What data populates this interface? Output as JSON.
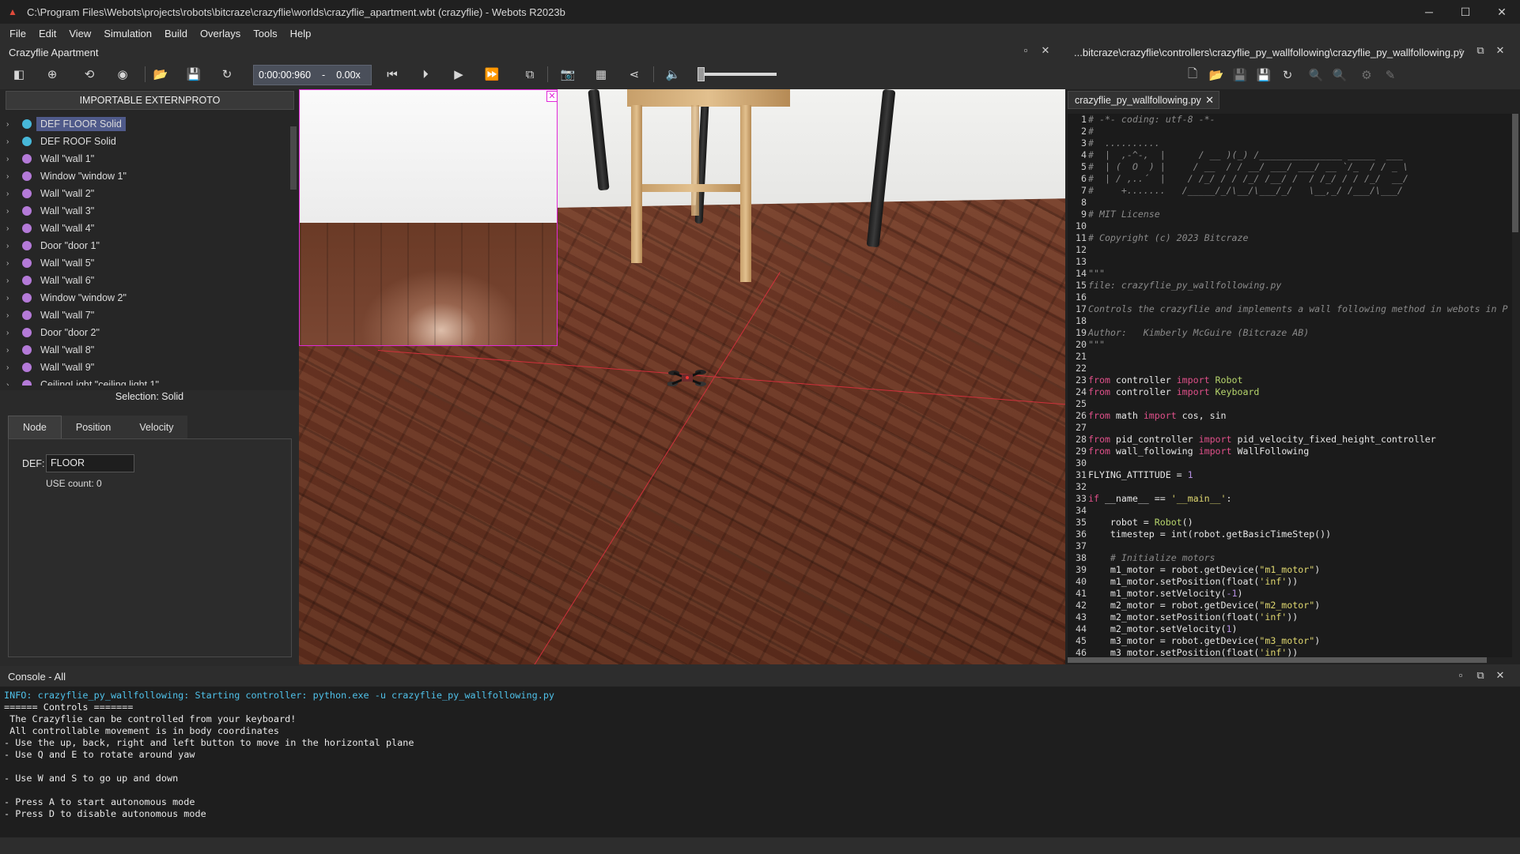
{
  "window": {
    "title": "C:\\Program Files\\Webots\\projects\\robots\\bitcraze\\crazyflie\\worlds\\crazyflie_apartment.wbt (crazyflie) - Webots R2023b"
  },
  "menu": [
    "File",
    "Edit",
    "View",
    "Simulation",
    "Build",
    "Overlays",
    "Tools",
    "Help"
  ],
  "world_panel": {
    "title": "Crazyflie Apartment",
    "time": "0:00:00:960",
    "speed": "0.00x"
  },
  "scene_tree": {
    "externproto_button": "IMPORTABLE EXTERNPROTO",
    "items": [
      {
        "label": "DEF FLOOR Solid",
        "color": "#47b8d9",
        "selected": true
      },
      {
        "label": "DEF ROOF Solid",
        "color": "#47b8d9"
      },
      {
        "label": "Wall \"wall 1\"",
        "color": "#b47ad8"
      },
      {
        "label": "Window \"window 1\"",
        "color": "#b47ad8"
      },
      {
        "label": "Wall \"wall 2\"",
        "color": "#b47ad8"
      },
      {
        "label": "Wall \"wall 3\"",
        "color": "#b47ad8"
      },
      {
        "label": "Wall \"wall 4\"",
        "color": "#b47ad8"
      },
      {
        "label": "Door \"door 1\"",
        "color": "#b47ad8"
      },
      {
        "label": "Wall \"wall 5\"",
        "color": "#b47ad8"
      },
      {
        "label": "Wall \"wall 6\"",
        "color": "#b47ad8"
      },
      {
        "label": "Window \"window 2\"",
        "color": "#b47ad8"
      },
      {
        "label": "Wall \"wall 7\"",
        "color": "#b47ad8"
      },
      {
        "label": "Door \"door 2\"",
        "color": "#b47ad8"
      },
      {
        "label": "Wall \"wall 8\"",
        "color": "#b47ad8"
      },
      {
        "label": "Wall \"wall 9\"",
        "color": "#b47ad8"
      },
      {
        "label": "CeilingLight \"ceiling light 1\"",
        "color": "#b47ad8"
      }
    ]
  },
  "selection": {
    "title": "Selection: Solid",
    "tabs": [
      "Node",
      "Position",
      "Velocity"
    ],
    "def_label": "DEF:",
    "def_value": "FLOOR",
    "use_count": "USE count: 0"
  },
  "editor": {
    "path": "...bitcraze\\crazyflie\\controllers\\crazyflie_py_wallfollowing\\crazyflie_py_wallfollowing.py",
    "tab": "crazyflie_py_wallfollowing.py"
  },
  "code_lines": [
    [
      [
        "cmt",
        "# -*- coding: utf-8 -*-"
      ]
    ],
    [
      [
        "cmt",
        "#"
      ]
    ],
    [
      [
        "cmt",
        "#  .........."
      ]
    ],
    [
      [
        "cmt",
        "#  |  ,-^-,  |      / __ )(_) /_______________ _____  ___"
      ]
    ],
    [
      [
        "cmt",
        "#  | (  O  ) |     / __  / / __/ ___/ ___/ __ `/_  / / _ \\"
      ]
    ],
    [
      [
        "cmt",
        "#  | / ,..´  |    / /_/ / / /_/ /__/ /  / /_/ / / /_/  __/"
      ]
    ],
    [
      [
        "cmt",
        "#     +.......   /_____/_/\\__/\\___/_/   \\__,_/ /___/\\___/"
      ]
    ],
    [
      [
        "ct",
        ""
      ]
    ],
    [
      [
        "cmt",
        "# MIT License"
      ]
    ],
    [
      [
        "ct",
        ""
      ]
    ],
    [
      [
        "cmt",
        "# Copyright (c) 2023 Bitcraze"
      ]
    ],
    [
      [
        "ct",
        ""
      ]
    ],
    [
      [
        "ct",
        ""
      ]
    ],
    [
      [
        "cmt",
        "\"\"\""
      ]
    ],
    [
      [
        "cmt",
        "file: crazyflie_py_wallfollowing.py"
      ]
    ],
    [
      [
        "ct",
        ""
      ]
    ],
    [
      [
        "cmt",
        "Controls the crazyflie and implements a wall following method in webots in P"
      ]
    ],
    [
      [
        "ct",
        ""
      ]
    ],
    [
      [
        "cmt",
        "Author:   Kimberly McGuire (Bitcraze AB)"
      ]
    ],
    [
      [
        "cmt",
        "\"\"\""
      ]
    ],
    [
      [
        "ct",
        ""
      ]
    ],
    [
      [
        "ct",
        ""
      ]
    ],
    [
      [
        "kw",
        "from"
      ],
      [
        "ct",
        " controller "
      ],
      [
        "kw",
        "import"
      ],
      [
        "cls",
        " Robot"
      ]
    ],
    [
      [
        "kw",
        "from"
      ],
      [
        "ct",
        " controller "
      ],
      [
        "kw",
        "import"
      ],
      [
        "cls",
        " Keyboard"
      ]
    ],
    [
      [
        "ct",
        ""
      ]
    ],
    [
      [
        "kw",
        "from"
      ],
      [
        "ct",
        " math "
      ],
      [
        "kw",
        "import"
      ],
      [
        "ct",
        " cos, sin"
      ]
    ],
    [
      [
        "ct",
        ""
      ]
    ],
    [
      [
        "kw",
        "from"
      ],
      [
        "ct",
        " pid_controller "
      ],
      [
        "kw",
        "import"
      ],
      [
        "ct",
        " pid_velocity_fixed_height_controller"
      ]
    ],
    [
      [
        "kw",
        "from"
      ],
      [
        "ct",
        " wall_following "
      ],
      [
        "kw",
        "import"
      ],
      [
        "ct",
        " WallFollowing"
      ]
    ],
    [
      [
        "ct",
        ""
      ]
    ],
    [
      [
        "ct",
        "FLYING_ATTITUDE = "
      ],
      [
        "num",
        "1"
      ]
    ],
    [
      [
        "ct",
        ""
      ]
    ],
    [
      [
        "kw",
        "if"
      ],
      [
        "ct",
        " __name__ == "
      ],
      [
        "str",
        "'__main__'"
      ],
      [
        "ct",
        ":"
      ]
    ],
    [
      [
        "ct",
        ""
      ]
    ],
    [
      [
        "ct",
        "    robot = "
      ],
      [
        "cls",
        "Robot"
      ],
      [
        "ct",
        "()"
      ]
    ],
    [
      [
        "ct",
        "    timestep = int(robot.getBasicTimeStep())"
      ]
    ],
    [
      [
        "ct",
        ""
      ]
    ],
    [
      [
        "cmt",
        "    # Initialize motors"
      ]
    ],
    [
      [
        "ct",
        "    m1_motor = robot.getDevice("
      ],
      [
        "str",
        "\"m1_motor\""
      ],
      [
        "ct",
        ")"
      ]
    ],
    [
      [
        "ct",
        "    m1_motor.setPosition(float("
      ],
      [
        "str",
        "'inf'"
      ],
      [
        "ct",
        "))"
      ]
    ],
    [
      [
        "ct",
        "    m1_motor.setVelocity("
      ],
      [
        "num",
        "-1"
      ],
      [
        "ct",
        ")"
      ]
    ],
    [
      [
        "ct",
        "    m2_motor = robot.getDevice("
      ],
      [
        "str",
        "\"m2_motor\""
      ],
      [
        "ct",
        ")"
      ]
    ],
    [
      [
        "ct",
        "    m2_motor.setPosition(float("
      ],
      [
        "str",
        "'inf'"
      ],
      [
        "ct",
        "))"
      ]
    ],
    [
      [
        "ct",
        "    m2_motor.setVelocity("
      ],
      [
        "num",
        "1"
      ],
      [
        "ct",
        ")"
      ]
    ],
    [
      [
        "ct",
        "    m3_motor = robot.getDevice("
      ],
      [
        "str",
        "\"m3_motor\""
      ],
      [
        "ct",
        ")"
      ]
    ],
    [
      [
        "ct",
        "    m3_motor.setPosition(float("
      ],
      [
        "str",
        "'inf'"
      ],
      [
        "ct",
        "))"
      ]
    ]
  ],
  "console": {
    "title": "Console - All",
    "lines": [
      {
        "text": "INFO: crazyflie_py_wallfollowing: Starting controller: python.exe -u crazyflie_py_wallfollowing.py",
        "info": true
      },
      {
        "text": "====== Controls ======="
      },
      {
        "text": " The Crazyflie can be controlled from your keyboard!"
      },
      {
        "text": " All controllable movement is in body coordinates"
      },
      {
        "text": "- Use the up, back, right and left button to move in the horizontal plane"
      },
      {
        "text": "- Use Q and E to rotate around yaw"
      },
      {
        "text": ""
      },
      {
        "text": "- Use W and S to go up and down"
      },
      {
        "text": ""
      },
      {
        "text": "- Press A to start autonomous mode"
      },
      {
        "text": "- Press D to disable autonomous mode"
      }
    ]
  }
}
